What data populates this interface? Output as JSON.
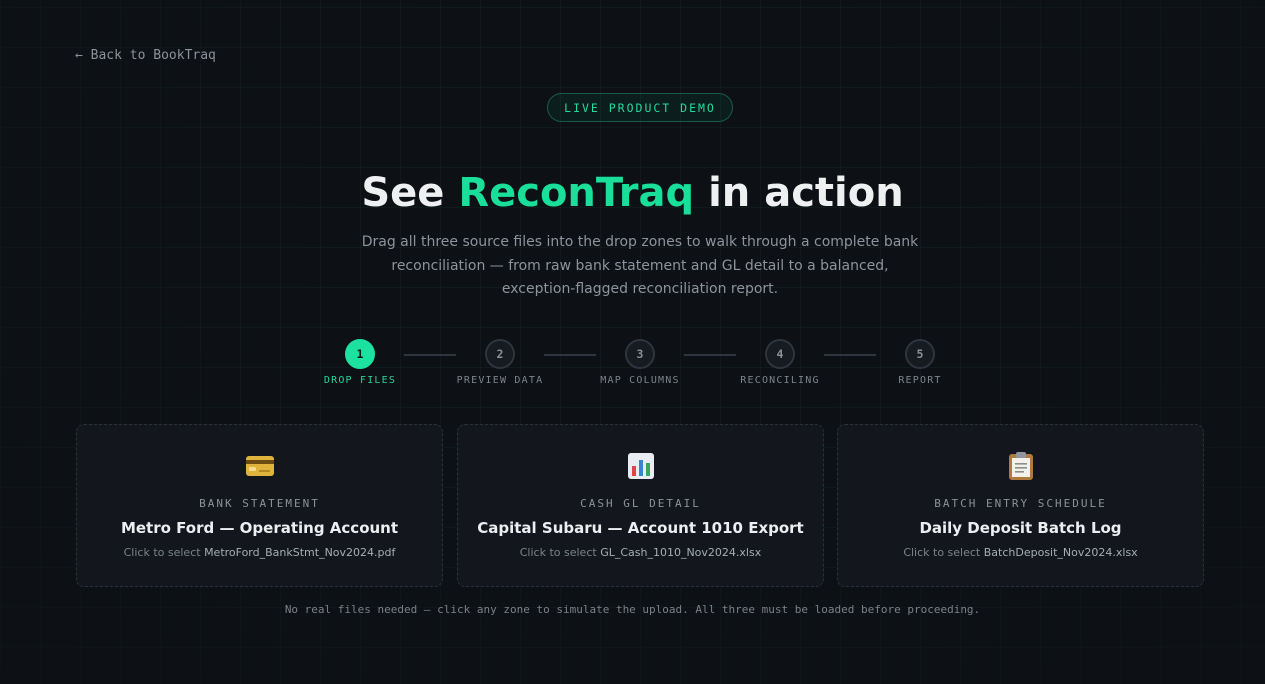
{
  "nav": {
    "back_label": "← Back to BookTraq"
  },
  "hero": {
    "badge": "LIVE PRODUCT DEMO",
    "title_pre": "See ",
    "title_accent": "ReconTraq",
    "title_post": " in action",
    "intro": "Drag all three source files into the drop zones to walk through a complete bank reconciliation — from raw bank statement and GL detail to a balanced, exception-flagged reconciliation report."
  },
  "steps": [
    {
      "number": "1",
      "label": "DROP FILES",
      "active": true
    },
    {
      "number": "2",
      "label": "PREVIEW DATA",
      "active": false
    },
    {
      "number": "3",
      "label": "MAP COLUMNS",
      "active": false
    },
    {
      "number": "4",
      "label": "RECONCILING",
      "active": false
    },
    {
      "number": "5",
      "label": "REPORT",
      "active": false
    }
  ],
  "zones": [
    {
      "icon": "credit-card-icon",
      "kicker": "BANK STATEMENT",
      "title": "Metro Ford — Operating Account",
      "prompt": "Click to select ",
      "filename": "MetroFord_BankStmt_Nov2024.pdf"
    },
    {
      "icon": "bar-chart-icon",
      "kicker": "CASH GL DETAIL",
      "title": "Capital Subaru — Account 1010 Export",
      "prompt": "Click to select ",
      "filename": "GL_Cash_1010_Nov2024.xlsx"
    },
    {
      "icon": "clipboard-icon",
      "kicker": "BATCH ENTRY SCHEDULE",
      "title": "Daily Deposit Batch Log",
      "prompt": "Click to select ",
      "filename": "BatchDeposit_Nov2024.xlsx"
    }
  ],
  "footnote": "No real files needed — click any zone to simulate the upload. All three must be loaded before proceeding.",
  "colors": {
    "accent": "#1de29f",
    "background": "#0d1014",
    "card": "#13171d"
  }
}
